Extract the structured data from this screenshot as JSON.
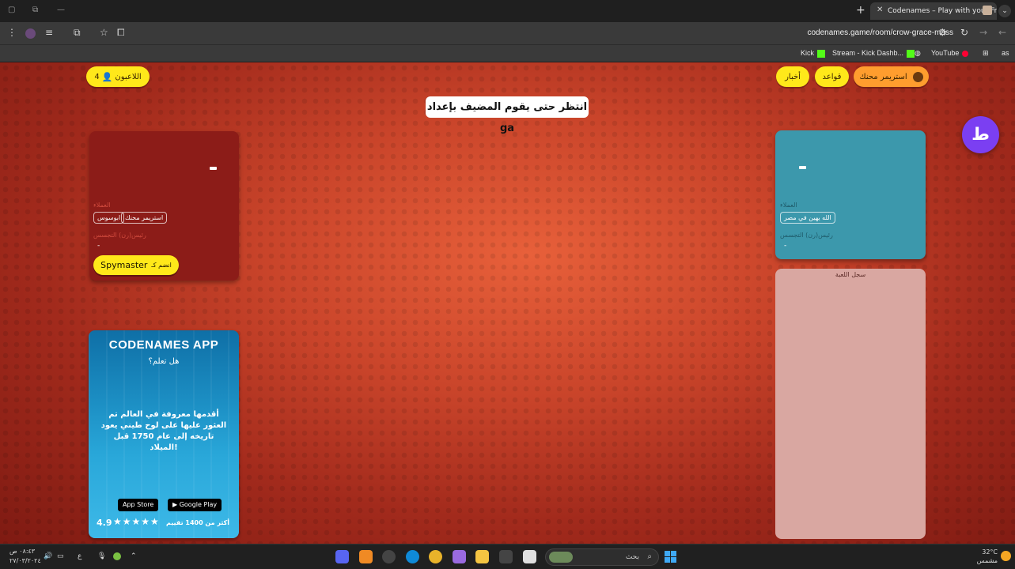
{
  "browser": {
    "tab_title": "Codenames – Play with your Fr",
    "url": "codenames.game/room/crow-grace-mass",
    "bookmarks": [
      {
        "label": "Kick"
      },
      {
        "label": "Stream - Kick Dashb..."
      },
      {
        "label": "YouTube"
      }
    ],
    "profile": "as"
  },
  "game": {
    "players_button": {
      "count": "4",
      "label": "اللاعبون"
    },
    "nickname_button": "استريمر محنك",
    "rules_button": "قواعد",
    "news_button": "أخبار",
    "waiting_message": "انتظر حتى يقوم المضيف بإعداد ga",
    "red_team": {
      "score": "-",
      "operatives_label": "العملاء",
      "operatives": [
        "استريمر محنك",
        "ابوسوس"
      ],
      "spymaster_label": "رئيس(رن) التجسس",
      "spymaster_value": "-",
      "join_button": {
        "label": "Spymaster",
        "prefix": "انضم كـ"
      }
    },
    "blue_team": {
      "score": "-",
      "operatives_label": "العملاء",
      "operatives": [
        "الله يهين في مصر"
      ],
      "spymaster_label": "رئيس(رن) التجسس",
      "spymaster_value": "-"
    },
    "game_log_title": "سجل اللعبة",
    "ad": {
      "title": "CODENAMES APP",
      "question": "هل تعلم؟",
      "body": "أقدمها معروفة في العالم تم العثور عليها على لوح طيني يعود تاريخه إلى عام 1750 قبل الميلاد!",
      "app_store": "App Store",
      "google_play": "Google Play",
      "rating": "4.9",
      "stars": "★★★★★",
      "reviews": "أكثر من 1400 تقييم"
    },
    "extension_badge": "ط"
  },
  "taskbar": {
    "search_label": "بحث",
    "clock_time": "٠٨:٤٣ ص",
    "clock_date": "٢٧/٠٣/٢٠٢٤",
    "weather_temp": "32°C",
    "weather_desc": "مشمس",
    "lang": "ع"
  },
  "colors": {
    "red_team": "#8c1c18",
    "blue_team": "#3c98ac",
    "accent_yellow": "#ffe81a",
    "accent_orange": "#ff9d2e"
  }
}
